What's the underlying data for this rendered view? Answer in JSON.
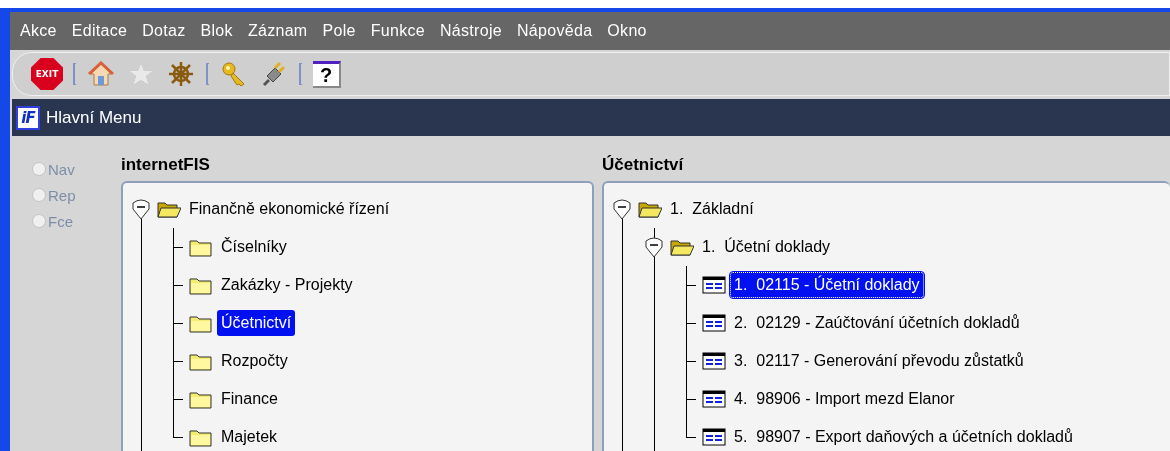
{
  "menu_bar": {
    "items": [
      "Akce",
      "Editace",
      "Dotaz",
      "Blok",
      "Záznam",
      "Pole",
      "Funkce",
      "Nástroje",
      "Nápověda",
      "Okno"
    ]
  },
  "toolbar": {
    "items": [
      {
        "kind": "exit",
        "label": "EXIT",
        "disabled": false
      },
      {
        "kind": "separator"
      },
      {
        "kind": "home",
        "disabled": false
      },
      {
        "kind": "star",
        "disabled": true
      },
      {
        "kind": "wheel",
        "disabled": false
      },
      {
        "kind": "separator"
      },
      {
        "kind": "key",
        "disabled": false
      },
      {
        "kind": "plug",
        "disabled": false
      },
      {
        "kind": "separator"
      },
      {
        "kind": "help",
        "label": "?",
        "disabled": false
      }
    ]
  },
  "window": {
    "logo": "iF",
    "title": "Hlavní Menu"
  },
  "mode_options": [
    {
      "label": "Nav",
      "selected": false,
      "disabled": true
    },
    {
      "label": "Rep",
      "selected": false,
      "disabled": true
    },
    {
      "label": "Fce",
      "selected": false,
      "disabled": true
    }
  ],
  "left_panel": {
    "title": "internetFIS",
    "tree": [
      {
        "label": "Finančně ekonomické řízení",
        "kind": "folder",
        "expanded": true,
        "selected": false,
        "children": [
          {
            "label": "Číselníky",
            "kind": "folder",
            "expanded": false,
            "selected": false
          },
          {
            "label": "Zakázky - Projekty",
            "kind": "folder",
            "expanded": false,
            "selected": false
          },
          {
            "label": "Účetnictví",
            "kind": "folder",
            "expanded": false,
            "selected": true
          },
          {
            "label": "Rozpočty",
            "kind": "folder",
            "expanded": false,
            "selected": false
          },
          {
            "label": "Finance",
            "kind": "folder",
            "expanded": false,
            "selected": false
          },
          {
            "label": "Majetek",
            "kind": "folder",
            "expanded": false,
            "selected": false
          }
        ]
      }
    ]
  },
  "right_panel": {
    "title": "Účetnictví",
    "tree": [
      {
        "label": "1.  Základní",
        "kind": "folder",
        "expanded": true,
        "selected": false,
        "children": [
          {
            "label": "1.  Účetní doklady",
            "kind": "folder",
            "expanded": true,
            "selected": false,
            "children": [
              {
                "label": "1.  02115 - Účetní doklady",
                "kind": "form",
                "selected": true,
                "focused": true
              },
              {
                "label": "2.  02129 - Zaúčtování účetních dokladů",
                "kind": "form",
                "selected": false,
                "focused": false
              },
              {
                "label": "3.  02117 - Generování převodu zůstatků",
                "kind": "form",
                "selected": false,
                "focused": false
              },
              {
                "label": "4.  98906 - Import mezd Elanor",
                "kind": "form",
                "selected": false,
                "focused": false
              },
              {
                "label": "5.  98907 - Export daňových a účetních dokladů",
                "kind": "form",
                "selected": false,
                "focused": false
              }
            ]
          }
        ]
      }
    ]
  }
}
